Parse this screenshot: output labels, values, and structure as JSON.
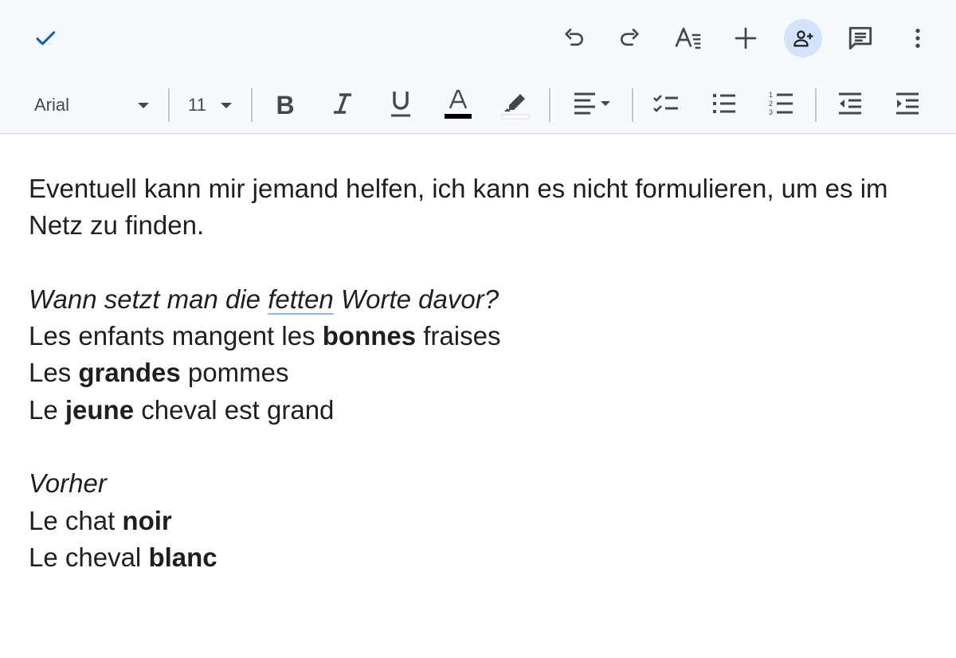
{
  "topbar": {
    "icons": [
      "check-icon",
      "undo-icon",
      "redo-icon",
      "text-format-icon",
      "add-icon",
      "add-person-icon",
      "comment-icon",
      "more-vert-icon"
    ]
  },
  "toolbar": {
    "font": "Arial",
    "size": "11",
    "bold_label": "B",
    "italic_label": "I",
    "underline_label": "U",
    "text_color_label": "A",
    "text_color": "#000000"
  },
  "document": {
    "p1": "Eventuell kann mir jemand helfen, ich kann es nicht formulieren, um es im Netz zu finden.",
    "q_part1": "Wann setzt man die ",
    "q_word": "fetten",
    "q_part2": " Worte davor?",
    "l1_a": "Les enfants mangent les ",
    "l1_b": "bonnes",
    "l1_c": " fraises",
    "l2_a": "Les ",
    "l2_b": "grandes",
    "l2_c": " pommes",
    "l3_a": "Le ",
    "l3_b": "jeune",
    "l3_c": " cheval est grand",
    "vorher": "Vorher",
    "l4_a": "Le chat ",
    "l4_b": "noir",
    "l5_a": "Le cheval ",
    "l5_b": "blanc"
  },
  "colors": {
    "accent": "#0b57d0",
    "toolbar_bg": "#f8f9fd",
    "share_bg": "#d3e3fd",
    "spell_underline": "#8ab4f8"
  }
}
